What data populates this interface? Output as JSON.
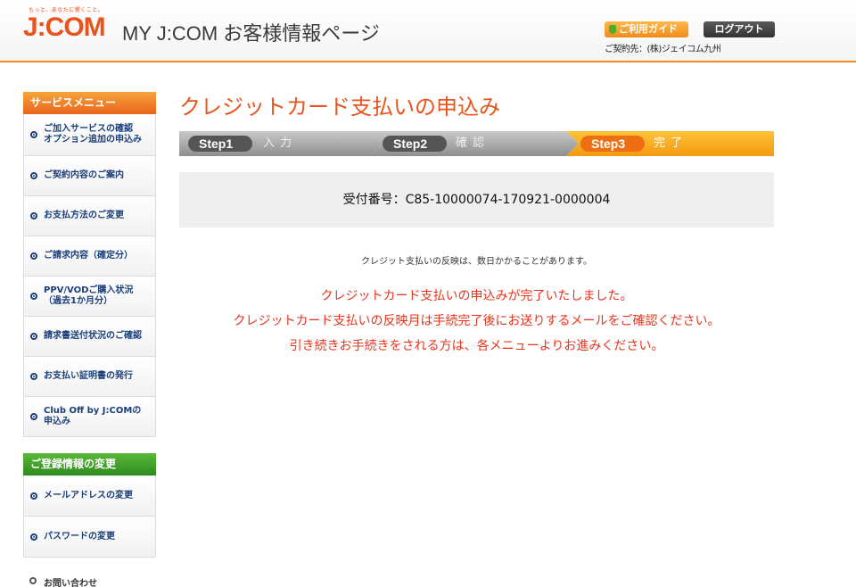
{
  "header": {
    "tagline": "もっと、あなたに響くこと。",
    "logo": "J:COM",
    "site_title": "MY J:COM お客様情報ページ",
    "guide_label": "ご利用ガイド",
    "logout_label": "ログアウト",
    "contract_text": "ご契約先：(株)ジェイコム九州"
  },
  "sidebar": {
    "service_menu_title": "サービスメニュー",
    "service_items": [
      {
        "line1": "ご加入サービスの確認",
        "line2": "オプション追加の申込み"
      },
      {
        "line1": "ご契約内容のご案内",
        "line2": ""
      },
      {
        "line1": "お支払方法のご変更",
        "line2": ""
      },
      {
        "line1": "ご請求内容（確定分）",
        "line2": ""
      },
      {
        "line1": "PPV/VODご購入状況",
        "line2": "（過去1か月分）"
      },
      {
        "line1": "請求書送付状況のご確認",
        "line2": ""
      },
      {
        "line1": "お支払い証明書の発行",
        "line2": ""
      },
      {
        "line1": "Club Off by J:COMの",
        "line2": "申込み"
      }
    ],
    "registration_title": "ご登録情報の変更",
    "registration_items": [
      {
        "line1": "メールアドレスの変更"
      },
      {
        "line1": "パスワードの変更"
      }
    ],
    "contact_label": "お問い合わせ"
  },
  "main": {
    "title": "クレジットカード支払いの申込み",
    "steps": [
      {
        "label": "Step1",
        "name": "入力"
      },
      {
        "label": "Step2",
        "name": "確認"
      },
      {
        "label": "Step3",
        "name": "完了"
      }
    ],
    "receipt_label": "受付番号：",
    "receipt_number": "C85-10000074-170921-0000004",
    "note": "クレジット支払いの反映は、数日かかることがあります。",
    "messages": [
      "クレジットカード支払いの申込みが完了いたしました。",
      "クレジットカード支払いの反映月は手続完了後にお送りするメールをご確認ください。",
      "引き続きお手続きをされる方は、各メニューよりお進みください。"
    ]
  },
  "colors": {
    "brand": "#e8541c",
    "accent_orange": "#f08a24",
    "green": "#2e8b1e",
    "link": "#1a3f7a",
    "message": "#e8341c"
  }
}
